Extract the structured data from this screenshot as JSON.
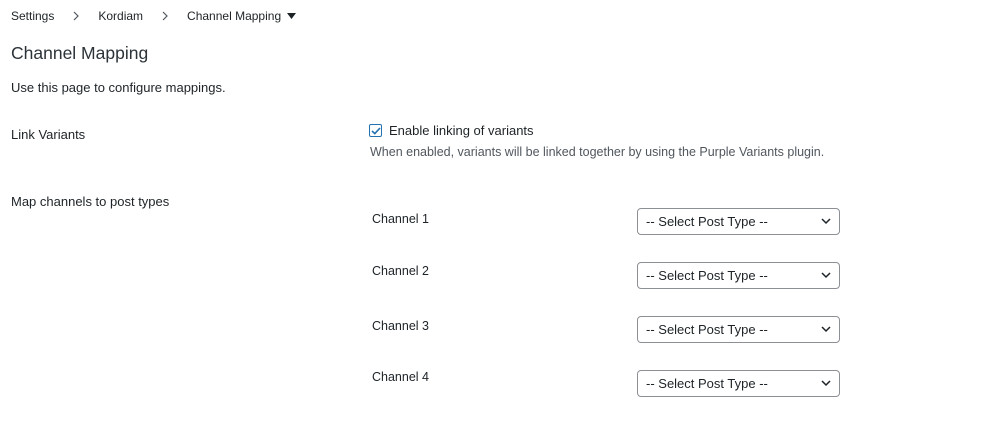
{
  "breadcrumb": {
    "items": [
      "Settings",
      "Kordiam"
    ],
    "current": "Channel Mapping"
  },
  "page": {
    "title": "Channel Mapping",
    "description": "Use this page to configure mappings."
  },
  "link_variants": {
    "label": "Link Variants",
    "checkbox_label": "Enable linking of variants",
    "checked": true,
    "help": "When enabled, variants will be linked together by using the Purple Variants plugin."
  },
  "mapping": {
    "label": "Map channels to post types",
    "channels": [
      {
        "name": "Channel 1",
        "selected": "-- Select Post Type --"
      },
      {
        "name": "Channel 2",
        "selected": "-- Select Post Type --"
      },
      {
        "name": "Channel 3",
        "selected": "-- Select Post Type --"
      },
      {
        "name": "Channel 4",
        "selected": "-- Select Post Type --"
      }
    ]
  },
  "colors": {
    "accent": "#2271b1",
    "text": "#1d2327",
    "border": "#8c8f94"
  }
}
